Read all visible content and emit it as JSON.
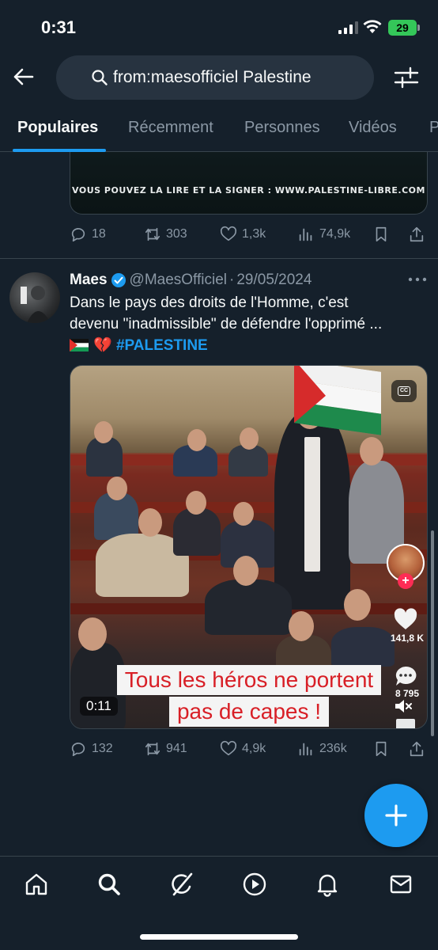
{
  "status_bar": {
    "time": "0:31",
    "battery": "29"
  },
  "search": {
    "query": "from:maesofficiel Palestine"
  },
  "tabs": [
    {
      "label": "Populaires",
      "active": true
    },
    {
      "label": "Récemment",
      "active": false
    },
    {
      "label": "Personnes",
      "active": false
    },
    {
      "label": "Vidéos",
      "active": false
    },
    {
      "label": "P",
      "active": false
    }
  ],
  "tweet1": {
    "media_caption": "VOUS POUVEZ LA LIRE ET LA SIGNER : WWW.PALESTINE-LIBRE.COM",
    "replies": "18",
    "reposts": "303",
    "likes": "1,3k",
    "views": "74,9k"
  },
  "tweet2": {
    "name": "Maes",
    "handle": "@MaesOfficiel",
    "separator": "·",
    "date": "29/05/2024",
    "text_line1": "Dans le pays des droits de l'Homme, c'est",
    "text_line2": "devenu \"inadmissible\" de défendre l'opprimé ...",
    "emoji_heart": "💔",
    "hashtag": "#PALESTINE",
    "video": {
      "caption_line1": "Tous les héros ne portent",
      "caption_line2": "pas de capes !",
      "timer": "0:11",
      "tt_likes": "141,8 K",
      "tt_comments": "8 795"
    },
    "replies": "132",
    "reposts": "941",
    "likes": "4,9k",
    "views": "236k"
  },
  "colors": {
    "accent": "#1d9bf0",
    "background": "#15202b",
    "muted": "#8b98a5"
  },
  "icons": [
    "back-arrow-icon",
    "search-icon",
    "filter-icon",
    "reply-icon",
    "repost-icon",
    "like-icon",
    "views-icon",
    "bookmark-icon",
    "share-icon",
    "home-icon",
    "explore-icon",
    "grok-icon",
    "video-icon",
    "notifications-icon",
    "messages-icon",
    "compose-plus-icon"
  ]
}
